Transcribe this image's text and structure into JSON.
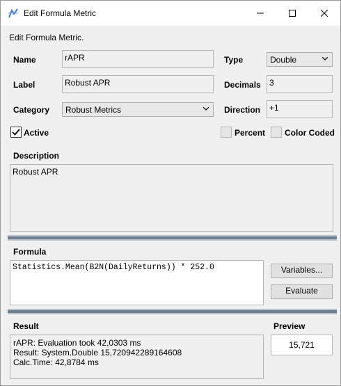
{
  "window": {
    "title": "Edit Formula Metric"
  },
  "header": {
    "subtitle": "Edit Formula Metric."
  },
  "form": {
    "name_label": "Name",
    "name_value": "rAPR",
    "label_label": "Label",
    "label_value": "Robust APR",
    "category_label": "Category",
    "category_value": "Robust Metrics",
    "type_label": "Type",
    "type_value": "Double",
    "decimals_label": "Decimals",
    "decimals_value": "3",
    "direction_label": "Direction",
    "direction_value": "+1",
    "active_label": "Active",
    "active_checked": true,
    "percent_label": "Percent",
    "percent_checked": false,
    "color_coded_label": "Color Coded",
    "color_coded_checked": false,
    "description_label": "Description",
    "description_value": "Robust APR"
  },
  "formula": {
    "label": "Formula",
    "value": "Statistics.Mean(B2N(DailyReturns)) * 252.0",
    "variables_button": "Variables...",
    "evaluate_button": "Evaluate"
  },
  "result": {
    "label": "Result",
    "lines": [
      "rAPR: Evaluation took 42,0303 ms",
      "Result: System.Double 15,720942289164608",
      "Calc.Time: 42,8784  ms"
    ],
    "preview_label": "Preview",
    "preview_value": "15,721"
  }
}
